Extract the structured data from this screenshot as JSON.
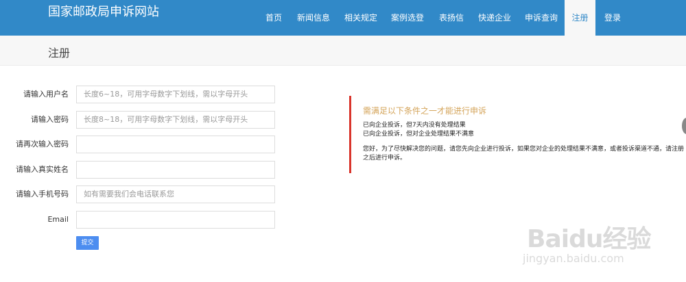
{
  "header": {
    "site_title": "国家邮政局申诉网站",
    "nav": [
      {
        "label": "首页"
      },
      {
        "label": "新闻信息"
      },
      {
        "label": "相关规定"
      },
      {
        "label": "案例选登"
      },
      {
        "label": "表扬信"
      },
      {
        "label": "快递企业"
      },
      {
        "label": "申诉查询"
      },
      {
        "label": "注册",
        "active": true
      },
      {
        "label": "登录"
      }
    ]
  },
  "page": {
    "title": "注册"
  },
  "form": {
    "fields": [
      {
        "label": "请输入用户名",
        "placeholder": "长度6~18，可用字母数字下划线，需以字母开头",
        "value": ""
      },
      {
        "label": "请输入密码",
        "placeholder": "长度8~18，可用字母数字下划线，需以字母开头",
        "value": ""
      },
      {
        "label": "请再次输入密码",
        "placeholder": "",
        "value": ""
      },
      {
        "label": "请输入真实姓名",
        "placeholder": "",
        "value": ""
      },
      {
        "label": "请输入手机号码",
        "placeholder": "如有需要我们会电话联系您",
        "value": ""
      },
      {
        "label": "Email",
        "placeholder": "",
        "value": ""
      }
    ],
    "submit_label": "提交"
  },
  "notice": {
    "title": "需满足以下条件之一才能进行申诉",
    "conditions": [
      "已向企业投诉，但7天内没有处理结果",
      "已向企业投诉，但对企业处理结果不满意"
    ],
    "body": "您好，为了尽快解决您的问题，请您先向企业进行投诉，如果您对企业的处理结果不满意，或者投诉渠道不通，请注册之后进行申诉。"
  },
  "watermark": {
    "logo": "Baidu经验",
    "url": "jingyan.baidu.com"
  },
  "colors": {
    "header_bg": "#3189c8",
    "accent_red": "#d9342b",
    "notice_title": "#d4a45a",
    "submit_bg": "#4c8df0"
  }
}
